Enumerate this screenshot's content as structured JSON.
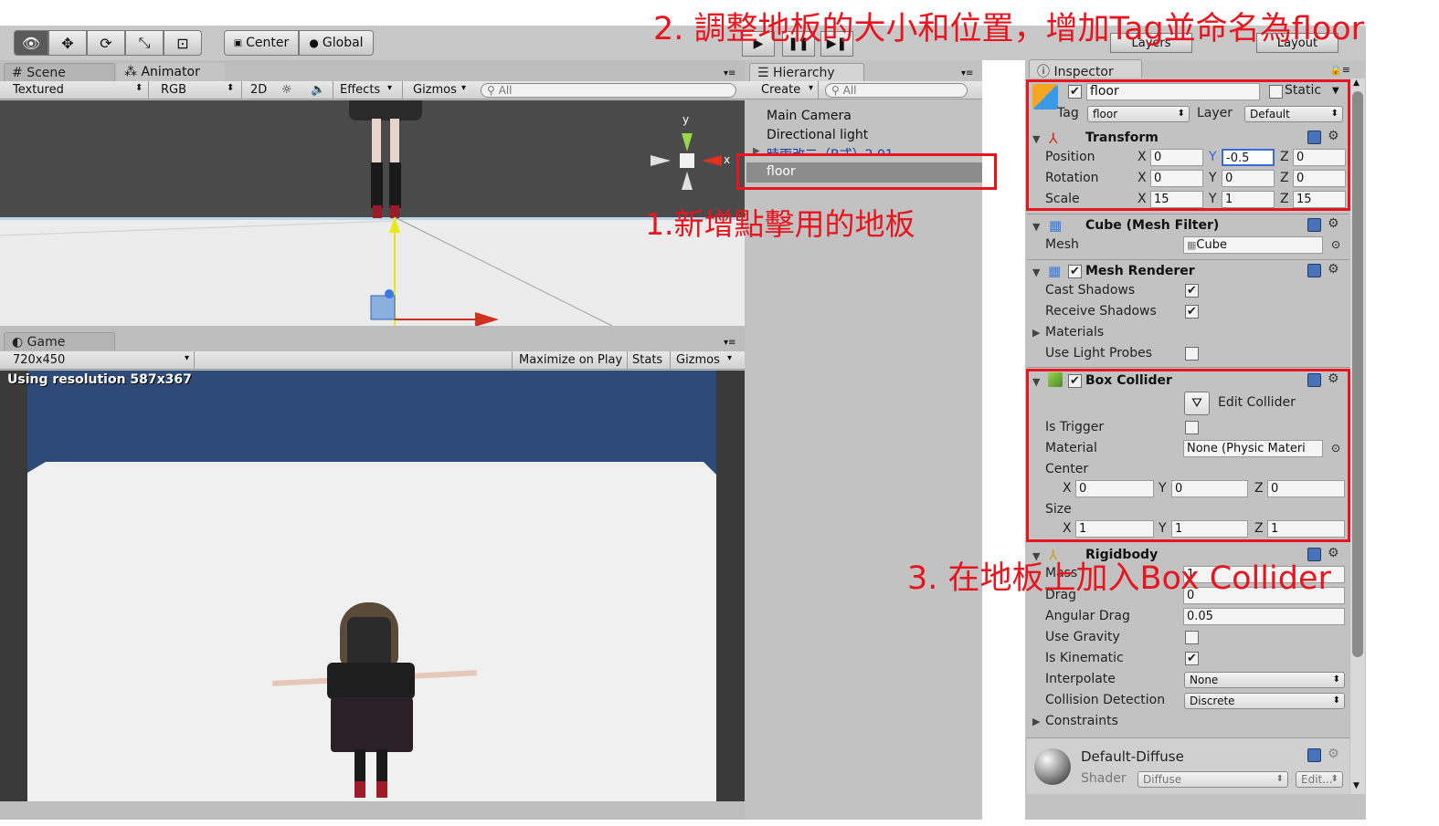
{
  "toolbar": {
    "center": "Center",
    "global": "Global",
    "layers": "Layers",
    "layout": "Layout"
  },
  "scene": {
    "tab_scene": "Scene",
    "tab_animator": "Animator",
    "textured": "Textured",
    "rgb": "RGB",
    "btn_2d": "2D",
    "effects": "Effects",
    "gizmos": "Gizmos",
    "search": "All",
    "axis_y": "y",
    "axis_x": "x"
  },
  "game": {
    "tab": "Game",
    "resolution": "720x450",
    "maximize": "Maximize on Play",
    "stats": "Stats",
    "gizmos": "Gizmos",
    "using_res": "Using resolution 587x367"
  },
  "hierarchy": {
    "tab": "Hierarchy",
    "create": "Create",
    "search": "All",
    "items": [
      "Main Camera",
      "Directional light",
      "時雨改二（B式）2.01",
      "floor"
    ]
  },
  "inspector": {
    "tab": "Inspector",
    "name": "floor",
    "static": "Static",
    "tag_label": "Tag",
    "tag_value": "floor",
    "layer_label": "Layer",
    "layer_value": "Default",
    "transform": {
      "title": "Transform",
      "position": "Position",
      "rotation": "Rotation",
      "scale": "Scale",
      "px": "0",
      "py": "-0.5",
      "pz": "0",
      "rx": "0",
      "ry": "0",
      "rz": "0",
      "sx": "15",
      "sy": "1",
      "sz": "15"
    },
    "meshfilter": {
      "title": "Cube (Mesh Filter)",
      "mesh": "Mesh",
      "mesh_value": "Cube"
    },
    "meshrenderer": {
      "title": "Mesh Renderer",
      "cast": "Cast Shadows",
      "receive": "Receive Shadows",
      "materials": "Materials",
      "probes": "Use Light Probes"
    },
    "boxcollider": {
      "title": "Box Collider",
      "edit": "Edit Collider",
      "trigger": "Is Trigger",
      "material": "Material",
      "material_value": "None (Physic Materi",
      "center": "Center",
      "cx": "0",
      "cy": "0",
      "cz": "0",
      "size": "Size",
      "sx": "1",
      "sy": "1",
      "sz": "1"
    },
    "rigidbody": {
      "title": "Rigidbody",
      "mass": "Mass",
      "mass_value": "1",
      "drag": "Drag",
      "drag_value": "0",
      "angular": "Angular Drag",
      "angular_value": "0.05",
      "gravity": "Use Gravity",
      "kinematic": "Is Kinematic",
      "interpolate": "Interpolate",
      "interpolate_value": "None",
      "collision": "Collision Detection",
      "collision_value": "Discrete",
      "constraints": "Constraints"
    },
    "material": {
      "name": "Default-Diffuse",
      "shader": "Shader",
      "shader_value": "Diffuse",
      "edit": "Edit..."
    },
    "x": "X",
    "y": "Y",
    "z": "Z"
  },
  "annotations": {
    "step1": "1.新增點擊用的地板",
    "step2": "2. 調整地板的大小和位置，增加Tag並命名為floor",
    "step3": "3. 在地板上加入Box Collider"
  },
  "colors": {
    "accent_red": "#e8141e",
    "game_sky": "#2e4b78"
  }
}
